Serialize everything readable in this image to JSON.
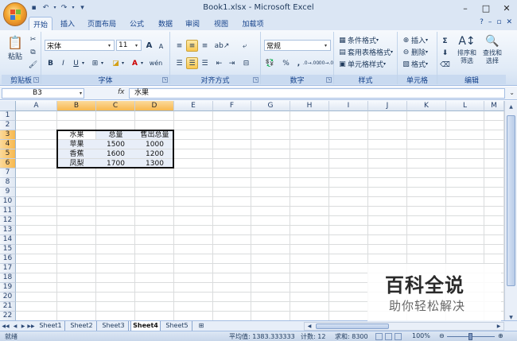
{
  "window": {
    "title": "Book1.xlsx - Microsoft Excel",
    "controls": [
      "–",
      "□",
      "✕"
    ]
  },
  "quick_access": {
    "undo_icon": "undo-icon",
    "redo_icon": "redo-icon",
    "save_icon": "save-icon",
    "customize": "▾"
  },
  "ribbon_tabs": [
    "开始",
    "插入",
    "页面布局",
    "公式",
    "数据",
    "审阅",
    "视图",
    "加载项"
  ],
  "ribbon_tabs_right": [
    "?",
    "–",
    "▫",
    "✕"
  ],
  "ribbon": {
    "clipboard": {
      "label": "剪贴板",
      "paste": "粘贴"
    },
    "font": {
      "label": "字体",
      "font_name": "宋体",
      "font_size": "11",
      "grow": "A",
      "shrink": "A",
      "bold": "B",
      "italic": "I",
      "underline": "U",
      "phonetic": "wén"
    },
    "alignment": {
      "label": "对齐方式"
    },
    "number": {
      "label": "数字",
      "format": "常规",
      "percent": "%",
      "comma": ",",
      "inc_dec": ".0→.00",
      "dec_dec": ".00→.0"
    },
    "styles": {
      "label": "样式",
      "conditional": "条件格式",
      "table": "套用表格格式",
      "cell_styles": "单元格样式"
    },
    "cells": {
      "label": "单元格",
      "insert": "插入",
      "delete": "删除",
      "format": "格式"
    },
    "editing": {
      "label": "编辑",
      "sigma": "Σ",
      "sort_filter": "排序和\n筛选",
      "find_select": "查找和\n选择",
      "sort_line1": "排序和",
      "sort_line2": "筛选",
      "find_line1": "查找和",
      "find_line2": "选择"
    }
  },
  "formula_bar": {
    "name_box": "B3",
    "fx": "fx",
    "value": "水果"
  },
  "grid": {
    "columns": [
      "A",
      "B",
      "C",
      "D",
      "E",
      "F",
      "G",
      "H",
      "I",
      "J",
      "K",
      "L",
      "M"
    ],
    "selected_columns": [
      "B",
      "C",
      "D"
    ],
    "rows": [
      "1",
      "2",
      "3",
      "4",
      "5",
      "6",
      "7",
      "8",
      "9",
      "10",
      "11",
      "12",
      "13",
      "14",
      "15",
      "16",
      "17",
      "18",
      "19",
      "20",
      "21",
      "22"
    ],
    "selected_rows": [
      "3",
      "4",
      "5",
      "6"
    ],
    "cells": [
      [
        "水果",
        "总量",
        "售出总量"
      ],
      [
        "苹果",
        "1500",
        "1000"
      ],
      [
        "香蕉",
        "1600",
        "1200"
      ],
      [
        "凤梨",
        "1700",
        "1300"
      ]
    ]
  },
  "sheets": [
    "Sheet1",
    "Sheet2",
    "Sheet3",
    "Sheet4",
    "Sheet5"
  ],
  "active_sheet": "Sheet4",
  "status": {
    "ready": "就绪",
    "average": "平均值: 1383.333333",
    "count": "计数: 12",
    "sum": "求和: 8300",
    "zoom": "100%"
  },
  "watermark": {
    "title": "百科全说",
    "subtitle": "助你轻松解决"
  },
  "colors": {
    "accent": "#f8b84e",
    "ribbon": "#dbe6f4",
    "selection_border": "#111111"
  }
}
